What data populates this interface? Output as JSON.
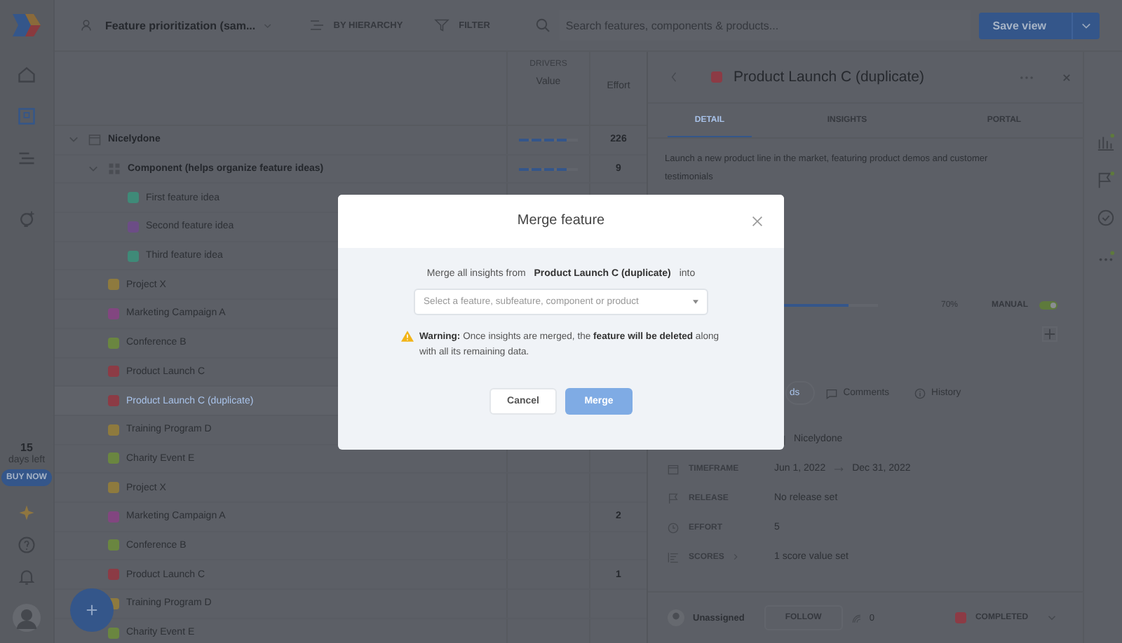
{
  "topbar": {
    "view_name": "Feature prioritization (sam...",
    "grouping": "BY HIERARCHY",
    "filter": "FILTER",
    "search": {
      "placeholder": "Search features, components & products..."
    },
    "save_button": "Save view"
  },
  "sidebar": {
    "items": [
      {
        "kind": "home",
        "selected": false
      },
      {
        "kind": "features",
        "selected": true
      },
      {
        "kind": "roadmap",
        "selected": false
      },
      {
        "kind": "insights",
        "selected": false
      }
    ],
    "trial": {
      "days": "15",
      "label": "days left",
      "button": "BUY NOW"
    }
  },
  "list": {
    "group_label": "DRIVERS",
    "columns": [
      "Value",
      "Effort"
    ],
    "rows": [
      {
        "name": "Nicelydone",
        "kind": "product",
        "expanded": true,
        "selected": false,
        "level": 0.8,
        "effort": "226",
        "children": [
          {
            "name": "Component (helps organize feature ideas)",
            "kind": "component",
            "expanded": true,
            "selected": false,
            "level": 0.8,
            "effort": "9",
            "children": [
              {
                "name": "First feature idea",
                "kind": "feature",
                "color": "#3f8a78",
                "selected": false
              },
              {
                "name": "Second feature idea",
                "kind": "feature",
                "color": "#6c4d86",
                "selected": false
              },
              {
                "name": "Third feature idea",
                "kind": "feature",
                "color": "#3f8a78",
                "selected": false
              }
            ]
          },
          {
            "name": "Project X",
            "kind": "feature",
            "color": "#8e7a3e",
            "selected": false
          },
          {
            "name": "Marketing Campaign A",
            "kind": "feature",
            "color": "#824680",
            "selected": false
          },
          {
            "name": "Conference B",
            "kind": "feature",
            "color": "#6a8640",
            "selected": false
          },
          {
            "name": "Product Launch C",
            "kind": "feature",
            "color": "#8c3b45",
            "selected": false
          },
          {
            "name": "Product Launch C (duplicate)",
            "kind": "feature",
            "color": "#8c3b45",
            "selected": true
          },
          {
            "name": "Training Program D",
            "kind": "feature",
            "color": "#8e7a3e",
            "selected": false
          },
          {
            "name": "Charity Event E",
            "kind": "feature",
            "color": "#6a8640",
            "selected": false
          },
          {
            "name": "Project X",
            "kind": "feature",
            "color": "#8e7a3e",
            "selected": false
          },
          {
            "name": "Marketing Campaign A",
            "kind": "feature",
            "color": "#824680",
            "selected": false,
            "effort": "2"
          },
          {
            "name": "Conference B",
            "kind": "feature",
            "color": "#6a8640",
            "selected": false
          },
          {
            "name": "Product Launch C",
            "kind": "feature",
            "color": "#8c3b45",
            "selected": false,
            "effort": "1"
          },
          {
            "name": "Training Program D",
            "kind": "feature",
            "color": "#8e7a3e",
            "selected": false
          },
          {
            "name": "Charity Event E",
            "kind": "feature",
            "color": "#6a8640",
            "selected": false
          }
        ]
      }
    ]
  },
  "detail": {
    "title": "Product Launch C (duplicate)",
    "color": "#8c3b45",
    "tabs": [
      {
        "label": "DETAIL",
        "selected": true
      },
      {
        "label": "INSIGHTS",
        "selected": false
      },
      {
        "label": "PORTAL",
        "selected": false
      }
    ],
    "description": "Launch a new product line in the market, featuring product demos and customer testimonials",
    "progress": {
      "level": 0.7,
      "reading": "70%",
      "mode": "MANUAL",
      "manual": true
    },
    "activity_tabs": [
      {
        "label": "ds",
        "kind": "cut",
        "selected": true
      },
      {
        "label": "Comments",
        "kind": "comments",
        "selected": false
      },
      {
        "label": "History",
        "kind": "history",
        "selected": false
      }
    ],
    "properties": [
      {
        "kind": "product",
        "value": "Nicelydone"
      },
      {
        "kind": "timeframe",
        "label": "TIMEFRAME",
        "start": "Jun 1, 2022",
        "end": "Dec 31, 2022"
      },
      {
        "kind": "release",
        "label": "RELEASE",
        "value": "No release set"
      },
      {
        "kind": "effort",
        "label": "EFFORT",
        "value": "5"
      },
      {
        "kind": "scores",
        "label": "SCORES",
        "value": "1 score value set"
      }
    ],
    "footer": {
      "assignee": "Unassigned",
      "follow_button": "FOLLOW",
      "votes": "0",
      "status": {
        "label": "COMPLETED",
        "color": "#8c3b45"
      }
    }
  },
  "modal": {
    "title": "Merge feature",
    "message": "Merge all insights from **Product Launch C (duplicate)** into",
    "select": {
      "placeholder": "Select a feature, subfeature, component or product"
    },
    "warning": "**Warning:** Once insights are merged, the **feature will be deleted** along with all its remaining data.",
    "buttons": [
      {
        "label": "Cancel",
        "kind": "secondary",
        "disabled": false
      },
      {
        "label": "Merge",
        "kind": "primary",
        "disabled": true
      }
    ]
  }
}
